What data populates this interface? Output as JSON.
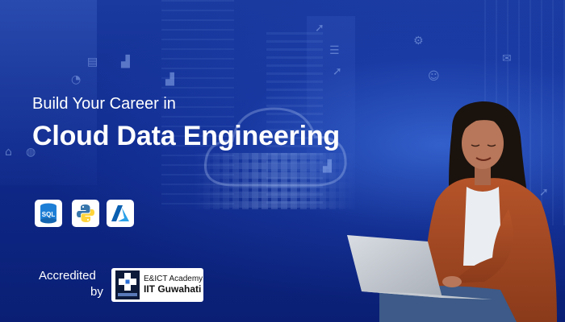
{
  "hero": {
    "line1": "Build Your Career in",
    "line2": "Cloud Data Engineering"
  },
  "tech_logos": [
    {
      "icon": "sql-icon",
      "label": "SQL",
      "color": "#1e7fd6"
    },
    {
      "icon": "python-icon",
      "colors": [
        "#3776ab",
        "#ffd43b"
      ]
    },
    {
      "icon": "azure-icon",
      "color": "#0078d4"
    }
  ],
  "accreditation": {
    "label": "Accredited",
    "by": "by",
    "org_line1": "E&ICT Academy",
    "org_line2": "IIT Guwahati"
  },
  "colors": {
    "background": "#0f2a8c",
    "text": "#ffffff"
  }
}
